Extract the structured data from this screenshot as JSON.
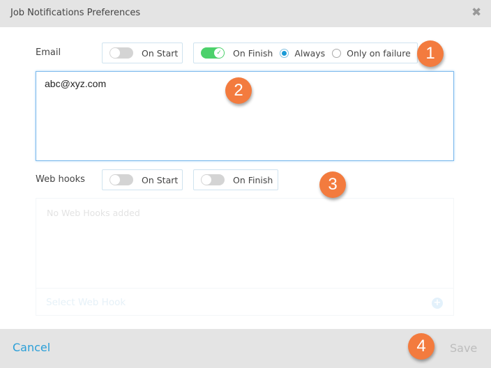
{
  "dialog": {
    "title": "Job Notifications Preferences",
    "close_icon": "close-icon"
  },
  "email": {
    "label": "Email",
    "on_start": {
      "label": "On Start",
      "enabled": false
    },
    "on_finish": {
      "label": "On Finish",
      "enabled": true
    },
    "finish_mode": {
      "options": [
        {
          "label": "Always",
          "selected": true
        },
        {
          "label": "Only on failure",
          "selected": false
        }
      ]
    },
    "recipients_value": "abc@xyz.com"
  },
  "webhooks": {
    "label": "Web hooks",
    "on_start": {
      "label": "On Start",
      "enabled": false
    },
    "on_finish": {
      "label": "On Finish",
      "enabled": false
    },
    "empty_text": "No Web Hooks added",
    "select_placeholder": "Select Web Hook",
    "add_icon": "plus-circle-icon"
  },
  "footer": {
    "cancel_label": "Cancel",
    "save_label": "Save"
  },
  "annotations": [
    "1",
    "2",
    "3",
    "4"
  ],
  "colors": {
    "accent": "#2a9fd8",
    "toggle_on": "#4cd16b",
    "badge": "#f37b3e",
    "header_bg": "#e4e4e4"
  }
}
